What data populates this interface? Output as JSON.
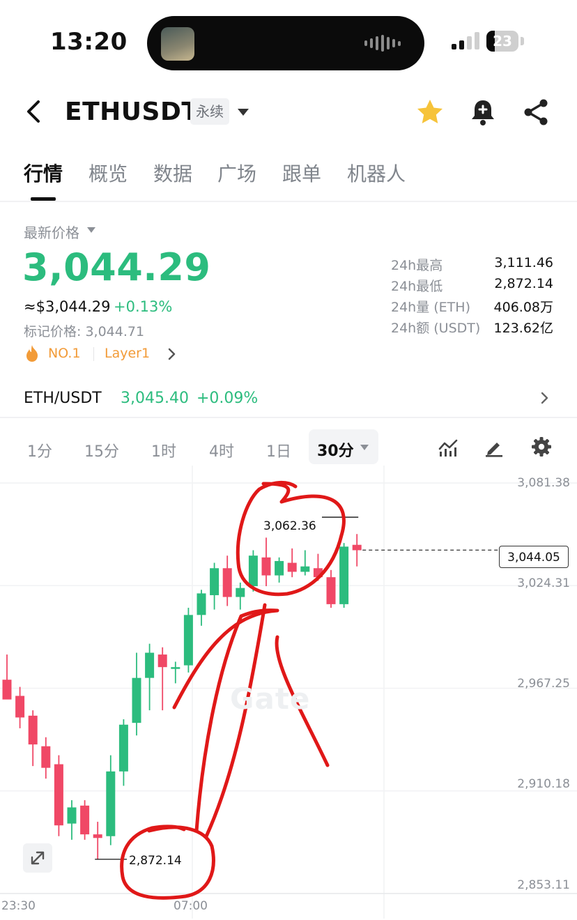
{
  "status_bar": {
    "time": "13:20",
    "battery": "23"
  },
  "header": {
    "symbol": "ETHUSDT",
    "contract_type": "永续"
  },
  "tabs": [
    {
      "label": "行情",
      "active": true
    },
    {
      "label": "概览"
    },
    {
      "label": "数据"
    },
    {
      "label": "广场"
    },
    {
      "label": "跟单"
    },
    {
      "label": "机器人"
    }
  ],
  "price_block": {
    "latest_label": "最新价格",
    "last_price": "3,044.29",
    "usd_approx": "≈$3,044.29",
    "change_pct": "+0.13%",
    "mark_price": "标记价格: 3,044.71",
    "rank_tag": "NO.1",
    "category_tag": "Layer1",
    "up_color": "#2cbc7e",
    "down_color": "#f04866",
    "tag_color": "#f29b38"
  },
  "stats": [
    {
      "label": "24h最高",
      "value": "3,111.46"
    },
    {
      "label": "24h最低",
      "value": "2,872.14"
    },
    {
      "label": "24h量 (ETH)",
      "value": "406.08万"
    },
    {
      "label": "24h额 (USDT)",
      "value": "123.62亿"
    }
  ],
  "spot": {
    "pair": "ETH/USDT",
    "price": "3,045.40",
    "change": "+0.09%"
  },
  "intervals": [
    {
      "label": "1分"
    },
    {
      "label": "15分"
    },
    {
      "label": "1时"
    },
    {
      "label": "4时"
    },
    {
      "label": "1日"
    }
  ],
  "active_interval": "30分",
  "chart_data": {
    "type": "candlestick",
    "interval": "30分",
    "y_axis_labels": [
      "3,081.38",
      "3,024.31",
      "2,967.25",
      "2,910.18",
      "2,853.11"
    ],
    "x_axis_labels": [
      "23:30",
      "07:00"
    ],
    "current_price": "3,044.05",
    "high_annotation": "3,062.36",
    "low_annotation": "2,872.14",
    "watermark": "Gate",
    "grid": true,
    "candles": [
      {
        "o": 2972,
        "h": 2986,
        "l": 2962,
        "c": 2961
      },
      {
        "o": 2963,
        "h": 2968,
        "l": 2945,
        "c": 2951
      },
      {
        "o": 2952,
        "h": 2955,
        "l": 2924,
        "c": 2936
      },
      {
        "o": 2935,
        "h": 2940,
        "l": 2917,
        "c": 2923
      },
      {
        "o": 2925,
        "h": 2930,
        "l": 2885,
        "c": 2891
      },
      {
        "o": 2892,
        "h": 2905,
        "l": 2883,
        "c": 2901
      },
      {
        "o": 2902,
        "h": 2905,
        "l": 2883,
        "c": 2886
      },
      {
        "o": 2886,
        "h": 2893,
        "l": 2872,
        "c": 2884
      },
      {
        "o": 2885,
        "h": 2930,
        "l": 2880,
        "c": 2921
      },
      {
        "o": 2921,
        "h": 2950,
        "l": 2913,
        "c": 2947
      },
      {
        "o": 2948,
        "h": 2987,
        "l": 2941,
        "c": 2973
      },
      {
        "o": 2973,
        "h": 2992,
        "l": 2955,
        "c": 2987
      },
      {
        "o": 2986,
        "h": 2990,
        "l": 2955,
        "c": 2979
      },
      {
        "o": 2978,
        "h": 2982,
        "l": 2970,
        "c": 2979
      },
      {
        "o": 2980,
        "h": 3012,
        "l": 2976,
        "c": 3008
      },
      {
        "o": 3008,
        "h": 3022,
        "l": 3002,
        "c": 3020
      },
      {
        "o": 3019,
        "h": 3037,
        "l": 3011,
        "c": 3034
      },
      {
        "o": 3034,
        "h": 3041,
        "l": 3013,
        "c": 3018
      },
      {
        "o": 3018,
        "h": 3026,
        "l": 3011,
        "c": 3023
      },
      {
        "o": 3024,
        "h": 3044,
        "l": 3021,
        "c": 3041
      },
      {
        "o": 3040,
        "h": 3051,
        "l": 3024,
        "c": 3030
      },
      {
        "o": 3030,
        "h": 3040,
        "l": 3026,
        "c": 3038
      },
      {
        "o": 3037,
        "h": 3045,
        "l": 3029,
        "c": 3032
      },
      {
        "o": 3032,
        "h": 3044,
        "l": 3030,
        "c": 3035
      },
      {
        "o": 3034,
        "h": 3042,
        "l": 3027,
        "c": 3029
      },
      {
        "o": 3029,
        "h": 3033,
        "l": 3012,
        "c": 3014
      },
      {
        "o": 3014,
        "h": 3048,
        "l": 3012,
        "c": 3046
      },
      {
        "o": 3047,
        "h": 3053,
        "l": 3035,
        "c": 3044
      }
    ]
  }
}
